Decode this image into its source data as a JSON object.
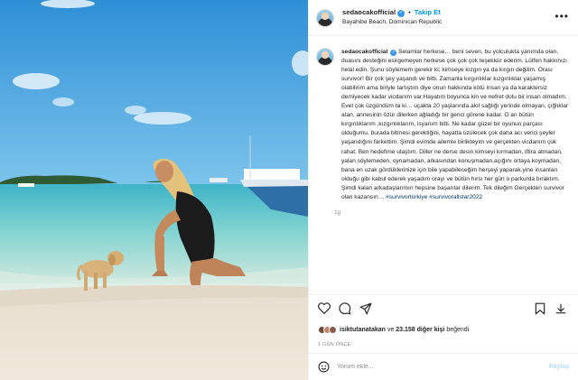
{
  "header": {
    "username": "sedaocakofficial",
    "follow_label": "Takip Et",
    "separator": "•",
    "location": "Bayahibe Beach, Dominican Republic"
  },
  "caption": {
    "username": "sedaocakofficial",
    "text": "Selamlar herkese… beni seven, bu yolculukta yanımda olan, duasını desteğini esirgemeyen herkese çok çok çok teşekkür ederim. Lütfen hakkınızı helal edin. Şunu söylemem gerekir ki; kimseye kızgın ya da kırgın değilim. Orası survivor! Bir çok şey yaşandı ve bitti. Zamanla kırgınlıklar kızgınlıklar yaşamış olabilirim ama biriyle tartıştım diye onun hakkında kötü insan ya da karaktersiz demiyecek kadar vicdanım var.Hayatım boyunca kin ve nefret dolu bir insan olmadım. Evet çok üzgündüm ta ki… uçakta 20 yaşlarında.akıl sağlığı yerinde olmayan, çığlıklar atan, annesinin özür dilerken ağladığı bir genci görene kadar. O an bütün kırgınlıklarım ,kızgınlıklarım, isyanım bitti. Ne kadar güzel bir oyunun parçası olduğumu, burada bitmesi gerektiğini, hayatta üzülecek çok daha acı verici şeyler yaşandığını farkettim. Şimdi evimde ailemle birlikteyim ve gerçekten vicdanım çok rahat. Ben hedefime ulaştım. Diller ne derse desin kimseyi kırmadan, iftira atmadan, yalan söylemeden, oynamadan, arkasından konuşmadan,açığını ortaya koymadan, bana en uzak gördüklerinize için bile yapabileceğim herşeyi yaparak.yine insanları olduğu gibi kabul ederek yaşadım orayı ve bütün hırsı her gün o parkurda bıraktım. Şimdi kalan arkadaşlarımın hepsine başarılar dilerim. Tek dileğim Gerçekten survivor olan kazansın…",
    "hashtag1": "#survivortürkiye",
    "hashtag2": "#survivorallstar2022",
    "age": "1g"
  },
  "likes": {
    "user": "isiktutanatakan",
    "connector": "ve",
    "others": "23.158 diğer kişi",
    "suffix": "beğendi"
  },
  "timestamp": "1 GÜN ÖNCE",
  "comment_box": {
    "placeholder": "Yorum ekle...",
    "post_label": "Paylaş"
  },
  "icons": [
    "heart-icon",
    "comment-icon",
    "share-icon",
    "save-icon",
    "download-icon",
    "emoji-icon",
    "more-icon",
    "verified-icon"
  ],
  "colors": {
    "accent": "#0095f6",
    "verified": "#3897f0",
    "hashtag": "#00376b",
    "muted": "#8e8e8e"
  }
}
